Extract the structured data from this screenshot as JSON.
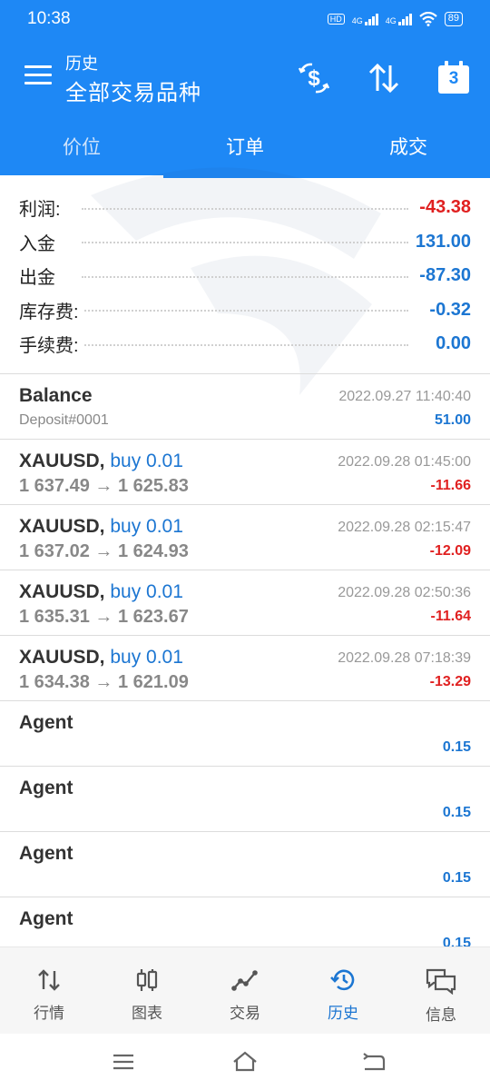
{
  "status": {
    "time": "10:38",
    "battery": "89",
    "net1": "4G",
    "net2": "4G",
    "hd": "HD"
  },
  "header": {
    "subtitle": "历史",
    "title": "全部交易品种",
    "calendar_day": "3"
  },
  "tabs": [
    {
      "label": "价位"
    },
    {
      "label": "订单"
    },
    {
      "label": "成交"
    }
  ],
  "summary": [
    {
      "label": "利润:",
      "value": "-43.38",
      "sign": "neg"
    },
    {
      "label": "入金",
      "value": "131.00",
      "sign": "pos"
    },
    {
      "label": "出金",
      "value": "-87.30",
      "sign": "pos"
    },
    {
      "label": "库存费:",
      "value": "-0.32",
      "sign": "pos"
    },
    {
      "label": "手续费:",
      "value": "0.00",
      "sign": "pos"
    }
  ],
  "deals": [
    {
      "title": "Balance",
      "buy": "",
      "detail": "Deposit#0001",
      "time": "2022.09.27 11:40:40",
      "amount": "51.00",
      "sign": "pos"
    },
    {
      "title": "XAUUSD,",
      "buy": " buy 0.01",
      "detail": "1 637.49 → 1 625.83",
      "time": "2022.09.28 01:45:00",
      "amount": "-11.66",
      "sign": "neg"
    },
    {
      "title": "XAUUSD,",
      "buy": " buy 0.01",
      "detail": "1 637.02 → 1 624.93",
      "time": "2022.09.28 02:15:47",
      "amount": "-12.09",
      "sign": "neg"
    },
    {
      "title": "XAUUSD,",
      "buy": " buy 0.01",
      "detail": "1 635.31 → 1 623.67",
      "time": "2022.09.28 02:50:36",
      "amount": "-11.64",
      "sign": "neg"
    },
    {
      "title": "XAUUSD,",
      "buy": " buy 0.01",
      "detail": "1 634.38 → 1 621.09",
      "time": "2022.09.28 07:18:39",
      "amount": "-13.29",
      "sign": "neg"
    },
    {
      "title": "Agent",
      "buy": "",
      "detail": "",
      "time": "",
      "amount": "0.15",
      "sign": "pos"
    },
    {
      "title": "Agent",
      "buy": "",
      "detail": "",
      "time": "",
      "amount": "0.15",
      "sign": "pos"
    },
    {
      "title": "Agent",
      "buy": "",
      "detail": "",
      "time": "",
      "amount": "0.15",
      "sign": "pos"
    },
    {
      "title": "Agent",
      "buy": "",
      "detail": "",
      "time": "",
      "amount": "0.15",
      "sign": "pos"
    }
  ],
  "nav": [
    {
      "label": "行情",
      "icon": "quotes-icon"
    },
    {
      "label": "图表",
      "icon": "chart-icon"
    },
    {
      "label": "交易",
      "icon": "trade-icon"
    },
    {
      "label": "历史",
      "icon": "history-icon",
      "active": true
    },
    {
      "label": "信息",
      "icon": "messages-icon"
    }
  ],
  "colors": {
    "primary": "#1e88f5",
    "negative": "#e02020",
    "positive": "#1c76d2"
  }
}
